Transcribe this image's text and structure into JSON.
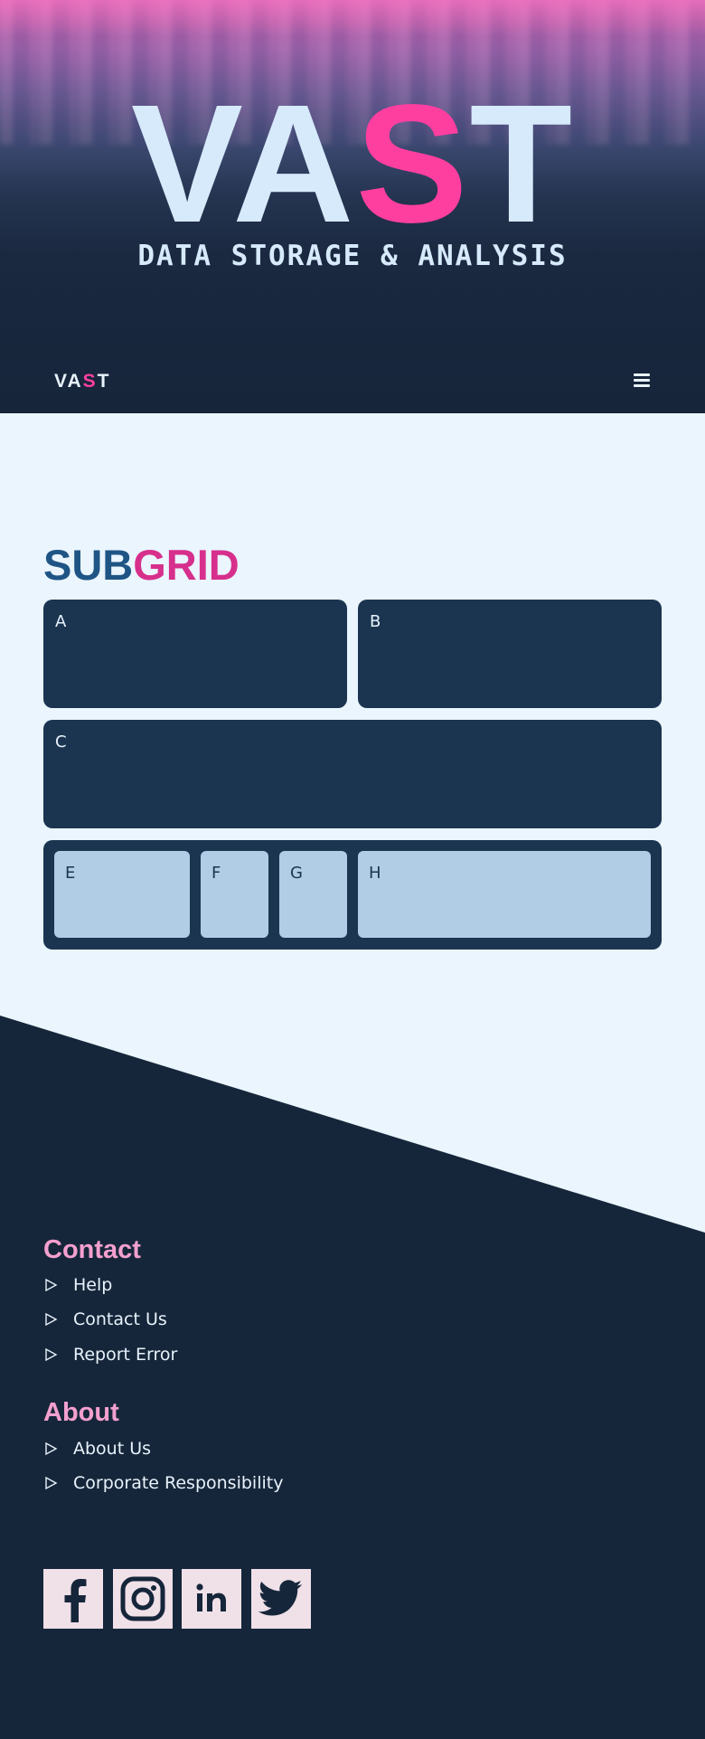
{
  "hero": {
    "title_part1": "VA",
    "title_highlight": "S",
    "title_part2": "T",
    "tagline": "DATA STORAGE & ANALYSIS"
  },
  "navbar": {
    "logo_part1": "VA",
    "logo_highlight": "S",
    "logo_part2": "T",
    "menu_icon": "hamburger-menu-icon"
  },
  "subgrid": {
    "title_part1": "SUB",
    "title_part2": "GRID",
    "cards": {
      "a": "A",
      "b": "B",
      "c": "C"
    },
    "inner_cards": {
      "e": "E",
      "f": "F",
      "g": "G",
      "h": "H"
    }
  },
  "footer": {
    "contact_heading": "Contact",
    "contact_links": [
      "Help",
      "Contact Us",
      "Report Error"
    ],
    "about_heading": "About",
    "about_links": [
      "About Us",
      "Corporate Responsibility"
    ],
    "social_icons": [
      "facebook-icon",
      "instagram-icon",
      "linkedin-icon",
      "twitter-icon"
    ]
  },
  "colors": {
    "accent_pink": "#ff3fa0",
    "subtitle_blue": "#1f5585",
    "subtitle_pink": "#d72f8c",
    "card_dark": "#1b3550",
    "card_light": "#b0cde5",
    "footer_bg": "#16263a",
    "footer_heading": "#f4a0cf",
    "page_bg": "#eaf5fe"
  }
}
